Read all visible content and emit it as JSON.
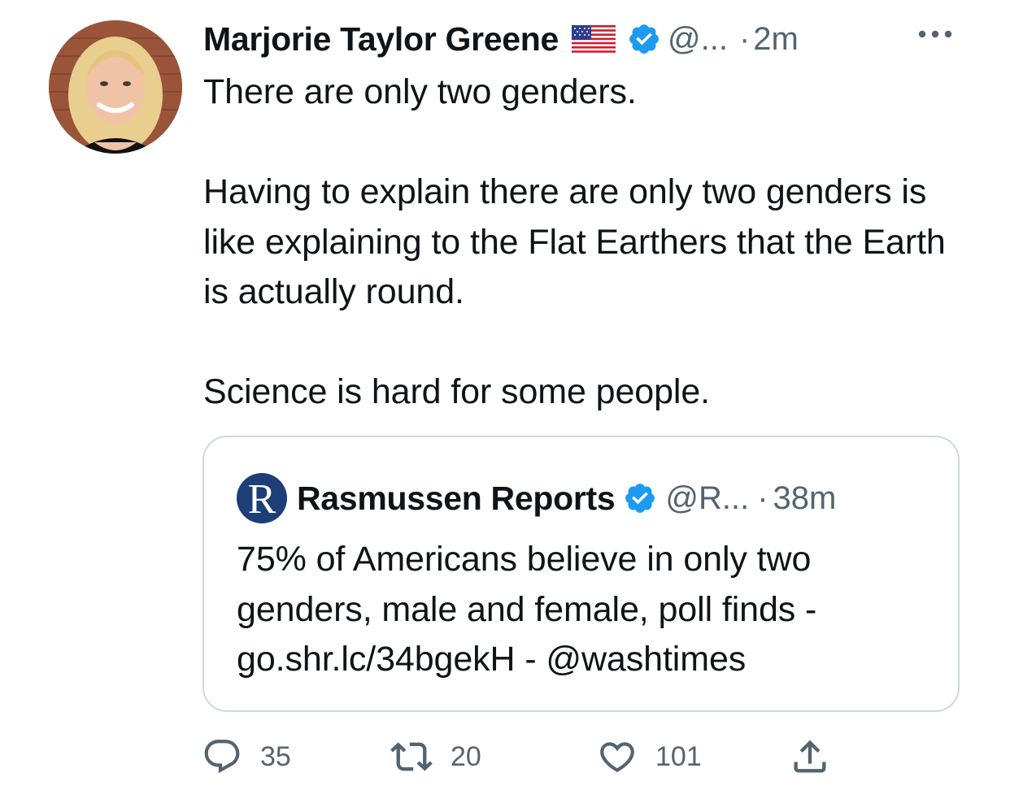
{
  "tweet": {
    "author": {
      "display_name": "Marjorie Taylor Greene",
      "flag_icon": "us-flag-icon",
      "verified_icon": "verified-badge-icon",
      "handle": "@...",
      "separator": "·",
      "time": "2m"
    },
    "more_icon": "more-options-icon",
    "text": {
      "line_1": "There are only two genders.",
      "paragraph_2": "Having to explain there are only two genders is like explaining to the Flat Earthers that the Earth is actually round.",
      "paragraph_3": "Science is hard for some people."
    },
    "quoted": {
      "avatar_letter": "R",
      "display_name": "Rasmussen Reports",
      "handle": "@R...",
      "separator": "·",
      "time": "38m",
      "text": "75% of Americans believe in only two genders, male and female, poll finds - go.shr.lc/34bgekH - @washtimes"
    },
    "actions": {
      "reply": {
        "icon": "reply-icon",
        "count": "35"
      },
      "retweet": {
        "icon": "retweet-icon",
        "count": "20"
      },
      "like": {
        "icon": "like-icon",
        "count": "101"
      },
      "share": {
        "icon": "share-icon"
      }
    }
  },
  "colors": {
    "text_primary": "#0f1419",
    "text_secondary": "#536471",
    "verified_blue": "#1d9bf0",
    "border": "#cfd9de",
    "rasmussen_navy": "#1d3e77"
  }
}
